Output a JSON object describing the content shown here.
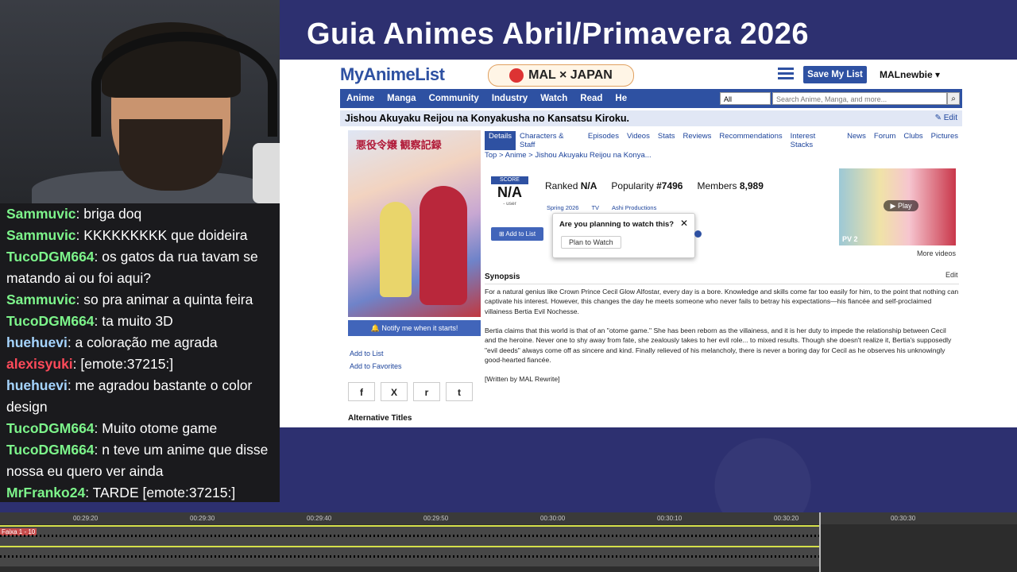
{
  "overlay_title": "Guia Animes Abril/Primavera 2026",
  "chat": [
    {
      "user": "Sammuvic",
      "color": "#7df58b",
      "text": ": briga doq"
    },
    {
      "user": "Sammuvic",
      "color": "#7df58b",
      "text": ": KKKKKKKKK que doideira"
    },
    {
      "user": "TucoDGM664",
      "color": "#7df58b",
      "text": ": os gatos da rua tavam se matando ai ou foi aqui?"
    },
    {
      "user": "Sammuvic",
      "color": "#7df58b",
      "text": ": so pra animar a quinta feira"
    },
    {
      "user": "TucoDGM664",
      "color": "#7df58b",
      "text": ": ta muito 3D"
    },
    {
      "user": "huehuevi",
      "color": "#a6d5ff",
      "text": ": a coloração me agrada"
    },
    {
      "user": "alexisyuki",
      "color": "#ff4a5a",
      "text": ": [emote:37215:]"
    },
    {
      "user": "huehuevi",
      "color": "#a6d5ff",
      "text": ": me agradou bastante o color design"
    },
    {
      "user": "TucoDGM664",
      "color": "#7df58b",
      "text": ": Muito otome game"
    },
    {
      "user": "TucoDGM664",
      "color": "#7df58b",
      "text": ": n teve um anime que disse nossa eu quero ver ainda"
    },
    {
      "user": "MrFranko24",
      "color": "#7df58b",
      "text": ": TARDE [emote:37215:]"
    }
  ],
  "mal": {
    "logo": "MyAnimeList",
    "promo": "MAL × JAPAN",
    "save_my_list": "Save My List",
    "username": "MALnewbie ▾",
    "nav": [
      "Anime",
      "Manga",
      "Community",
      "Industry",
      "Watch",
      "Read",
      "He"
    ],
    "search_select": "All",
    "search_placeholder": "Search Anime, Manga, and more...",
    "title": "Jishou Akuyaku Reijou na Konyakusha no Kansatsu Kiroku.",
    "edit": "✎ Edit",
    "tabs": [
      "Details",
      "Characters & Staff",
      "Episodes",
      "Videos",
      "Stats",
      "Reviews",
      "Recommendations",
      "Interest Stacks",
      "News",
      "Forum",
      "Clubs",
      "Pictures"
    ],
    "breadcrumb": "Top  >  Anime  >  Jishou Akuyaku Reijou na Konya...",
    "score_label": "SCORE",
    "score_value": "N/A",
    "score_users": "- user",
    "ranked_label": "Ranked",
    "ranked_value": "N/A",
    "popularity_label": "Popularity",
    "popularity_value": "#7496",
    "members_label": "Members",
    "members_value": "8,989",
    "season": "Spring 2026",
    "type": "TV",
    "studio": "Ashi Productions",
    "add_to_list": "Add to List",
    "popup_question": "Are you planning to watch this?",
    "popup_close": "✕",
    "plan_to_watch": "Plan to Watch",
    "poster_title": "悪役令嬢 観察記録",
    "video_play": "Play",
    "video_pv": "PV 2",
    "more_videos": "More videos",
    "notify": "🔔 Notify me when it starts!",
    "side_add_list": "Add to List",
    "side_add_fav": "Add to Favorites",
    "share": [
      "f",
      "X",
      "r",
      "t"
    ],
    "alt_titles": "Alternative Titles",
    "synopsis_heading": "Synopsis",
    "synopsis_edit": "Edit",
    "synopsis_p1": "For a natural genius like Crown Prince Cecil Glow Alfostar, every day is a bore. Knowledge and skills come far too easily for him, to the point that nothing can captivate his interest. However, this changes the day he meets someone who never fails to betray his expectations—his fiancée and self-proclaimed villainess Bertia Evil Nochesse.",
    "synopsis_p2": "Bertia claims that this world is that of an \"otome game.\" She has been reborn as the villainess, and it is her duty to impede the relationship between Cecil and the heroine. Never one to shy away from fate, she zealously takes to her evil role... to mixed results. Though she doesn't realize it, Bertia's supposedly \"evil deeds\" always come off as sincere and kind. Finally relieved of his melancholy, there is never a boring day for Cecil as he observes his unknowingly good-hearted fiancée.",
    "synopsis_source": "[Written by MAL Rewrite]"
  },
  "timeline": {
    "marks": [
      "00:29:20",
      "00:29:30",
      "00:29:40",
      "00:29:50",
      "00:30:00",
      "00:30:10",
      "00:30:20",
      "00:30:30"
    ],
    "track_label": "Faixa 1 - 10"
  }
}
